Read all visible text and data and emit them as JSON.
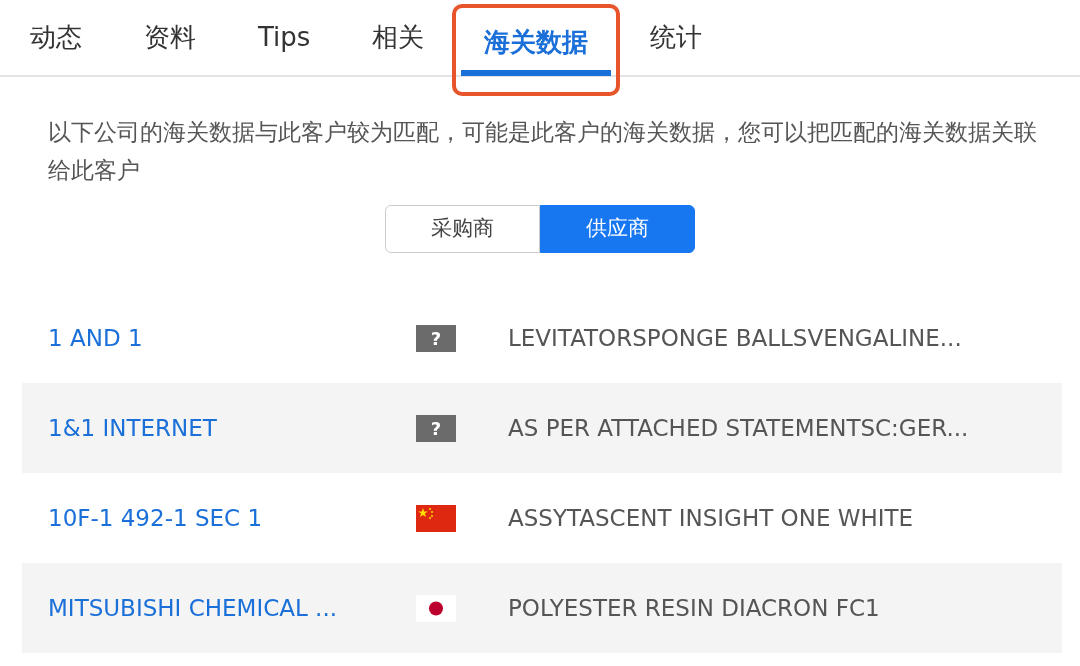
{
  "tabs": [
    {
      "label": "动态",
      "selected": false,
      "highlighted": false
    },
    {
      "label": "资料",
      "selected": false,
      "highlighted": false
    },
    {
      "label": "Tips",
      "selected": false,
      "highlighted": false
    },
    {
      "label": "相关",
      "selected": false,
      "highlighted": false
    },
    {
      "label": "海关数据",
      "selected": true,
      "highlighted": true
    },
    {
      "label": "统计",
      "selected": false,
      "highlighted": false
    }
  ],
  "description": "以下公司的海关数据与此客户较为匹配，可能是此客户的海关数据，您可以把匹配的海关数据关联给此客户",
  "segments": [
    {
      "label": "采购商",
      "selected": false
    },
    {
      "label": "供应商",
      "selected": true
    }
  ],
  "rows": [
    {
      "company": "1 AND 1",
      "kind": "unknown",
      "flag_text": "?",
      "product": "LEVITATORSPONGE BALLSVENGALINE..."
    },
    {
      "company": "1&1 INTERNET",
      "kind": "unknown",
      "flag_text": "?",
      "product": "AS PER ATTACHED STATEMENTSC:GER..."
    },
    {
      "company": "10F-1 492-1 SEC 1",
      "kind": "china",
      "product": "ASSYTASCENT INSIGHT ONE WHITE"
    },
    {
      "company": "MITSUBISHI CHEMICAL ...",
      "kind": "japan",
      "product": "POLYESTER RESIN DIACRON FC1"
    }
  ]
}
